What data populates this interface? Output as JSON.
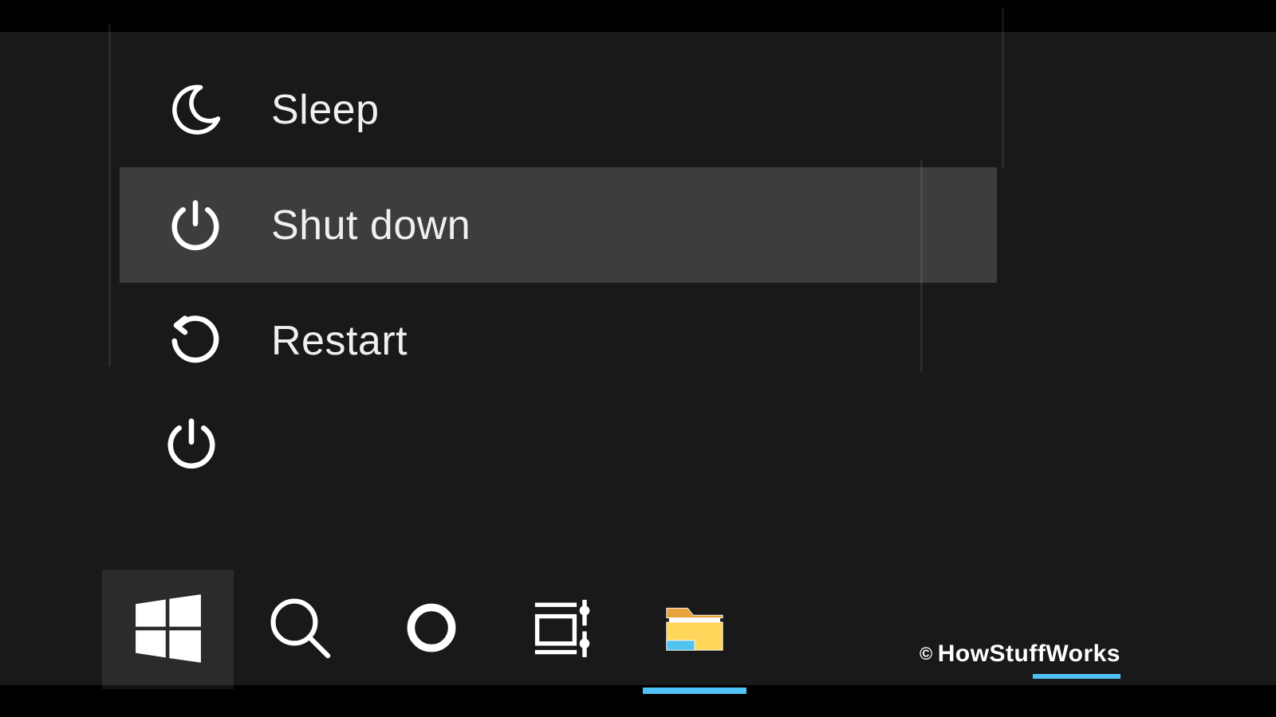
{
  "power_menu": {
    "items": [
      {
        "label": "Sleep",
        "icon": "moon-icon",
        "highlighted": false
      },
      {
        "label": "Shut down",
        "icon": "power-icon",
        "highlighted": true
      },
      {
        "label": "Restart",
        "icon": "restart-icon",
        "highlighted": false
      }
    ]
  },
  "sidebar": {
    "power_button_icon": "power-icon"
  },
  "taskbar": {
    "items": [
      {
        "name": "start",
        "icon": "windows-icon",
        "active": true
      },
      {
        "name": "search",
        "icon": "search-icon",
        "active": false
      },
      {
        "name": "cortana",
        "icon": "cortana-ring-icon",
        "active": false
      },
      {
        "name": "task-view",
        "icon": "task-view-icon",
        "active": false
      },
      {
        "name": "file-explorer",
        "icon": "file-explorer-icon",
        "active": false,
        "running": true
      }
    ]
  },
  "credit": {
    "symbol": "©",
    "text": "HowStuffWorks"
  }
}
